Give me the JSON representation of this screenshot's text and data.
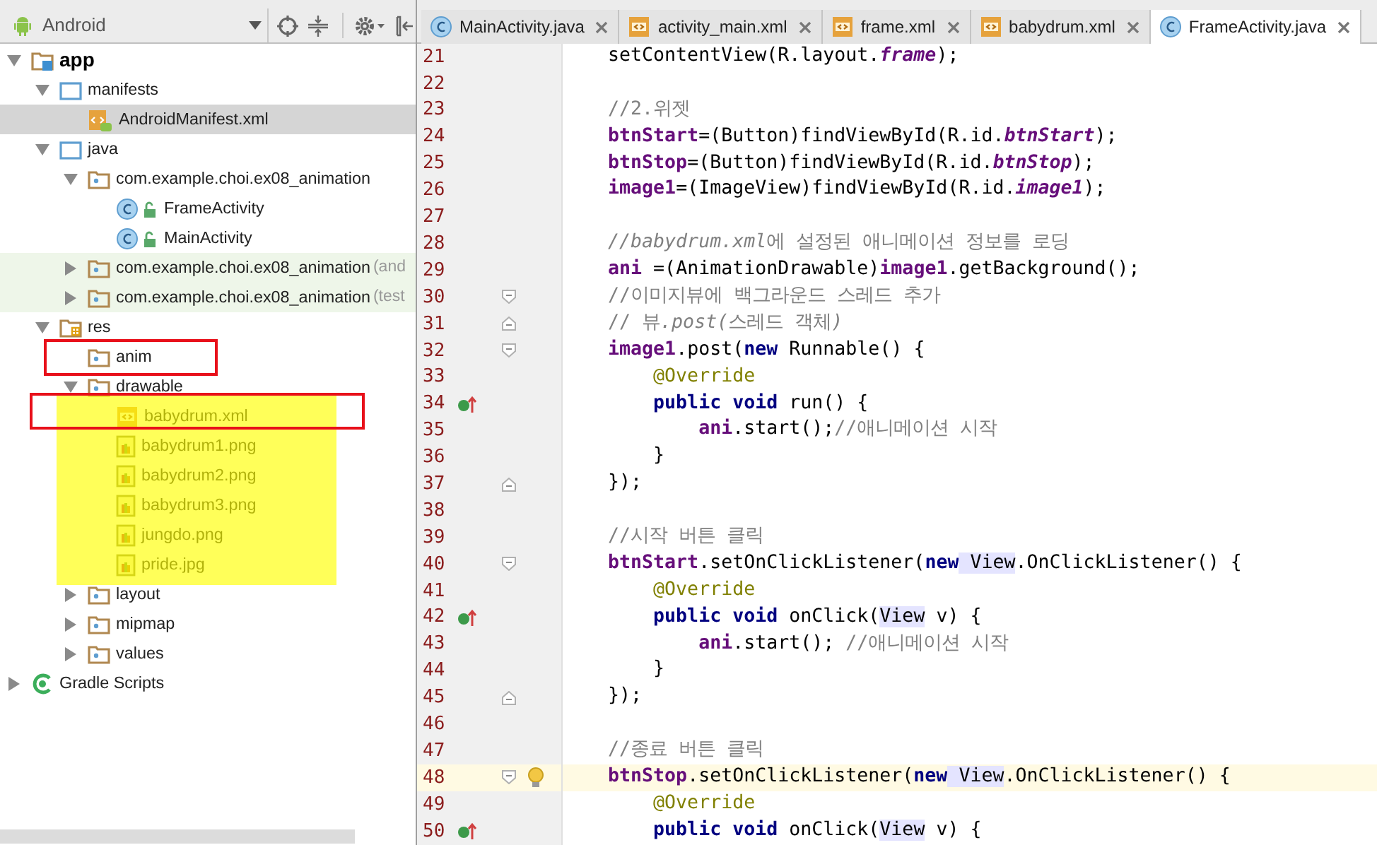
{
  "project_panel": {
    "view": "Android",
    "tree": [
      {
        "label": "app",
        "kind": "module",
        "expanded": true,
        "selected": false,
        "children": [
          {
            "label": "manifests",
            "kind": "folder",
            "expanded": true,
            "selected": false,
            "children": [
              {
                "label": "AndroidManifest.xml",
                "kind": "manifest",
                "selected": true
              }
            ]
          },
          {
            "label": "java",
            "kind": "folder",
            "expanded": true,
            "selected": false,
            "children": [
              {
                "label": "com.example.choi.ex08_animation",
                "kind": "package",
                "expanded": true,
                "selected": false,
                "children": [
                  {
                    "label": "FrameActivity",
                    "kind": "class",
                    "selected": false
                  },
                  {
                    "label": "MainActivity",
                    "kind": "class",
                    "selected": false
                  }
                ]
              },
              {
                "label": "com.example.choi.ex08_animation",
                "suffix": "(and",
                "kind": "package",
                "test": true,
                "expanded": false,
                "selected": false
              },
              {
                "label": "com.example.choi.ex08_animation",
                "suffix": "(test",
                "kind": "package",
                "test": true,
                "expanded": false,
                "selected": false
              }
            ]
          },
          {
            "label": "res",
            "kind": "res",
            "expanded": true,
            "selected": false,
            "children": [
              {
                "label": "anim",
                "kind": "resdir",
                "selected": false
              },
              {
                "label": "drawable",
                "kind": "resdir",
                "expanded": true,
                "selected": false,
                "children": [
                  {
                    "label": "babydrum.xml",
                    "kind": "xml",
                    "selected": false
                  },
                  {
                    "label": "babydrum1.png",
                    "kind": "image",
                    "selected": false
                  },
                  {
                    "label": "babydrum2.png",
                    "kind": "image",
                    "selected": false
                  },
                  {
                    "label": "babydrum3.png",
                    "kind": "image",
                    "selected": false
                  },
                  {
                    "label": "jungdo.png",
                    "kind": "image",
                    "selected": false
                  },
                  {
                    "label": "pride.jpg",
                    "kind": "image",
                    "selected": false
                  }
                ]
              },
              {
                "label": "layout",
                "kind": "resdir",
                "expanded": false,
                "selected": false
              },
              {
                "label": "mipmap",
                "kind": "resdir",
                "expanded": false,
                "selected": false
              },
              {
                "label": "values",
                "kind": "resdir",
                "expanded": false,
                "selected": false
              }
            ]
          }
        ]
      },
      {
        "label": "Gradle Scripts",
        "kind": "gradle",
        "expanded": false,
        "selected": false
      }
    ]
  },
  "editor": {
    "tabs": [
      {
        "label": "MainActivity.java",
        "kind": "class",
        "selected": false
      },
      {
        "label": "activity_main.xml",
        "kind": "xml",
        "selected": false
      },
      {
        "label": "frame.xml",
        "kind": "xml",
        "selected": false
      },
      {
        "label": "babydrum.xml",
        "kind": "xml",
        "selected": false
      },
      {
        "label": "FrameActivity.java",
        "kind": "class",
        "selected": true
      }
    ],
    "lines": [
      {
        "number": "21",
        "tokens": [
          {
            "kind": "plain",
            "text": "    setContentView(R.layout."
          },
          {
            "kind": "static",
            "text": "frame"
          },
          {
            "kind": "plain",
            "text": ");"
          }
        ]
      },
      {
        "number": "22"
      },
      {
        "number": "23",
        "tokens": [
          {
            "kind": "comment",
            "text": "    //2.위젯"
          }
        ]
      },
      {
        "number": "24",
        "tokens": [
          {
            "kind": "field",
            "text": "    btnStart"
          },
          {
            "kind": "plain",
            "text": "=(Button)findViewById(R.id."
          },
          {
            "kind": "static",
            "text": "btnStart"
          },
          {
            "kind": "plain",
            "text": ");"
          }
        ]
      },
      {
        "number": "25",
        "tokens": [
          {
            "kind": "field",
            "text": "    btnStop"
          },
          {
            "kind": "plain",
            "text": "=(Button)findViewById(R.id."
          },
          {
            "kind": "static",
            "text": "btnStop"
          },
          {
            "kind": "plain",
            "text": ");"
          }
        ]
      },
      {
        "number": "26",
        "tokens": [
          {
            "kind": "field",
            "text": "    image1"
          },
          {
            "kind": "plain",
            "text": "=(ImageView)findViewById(R.id."
          },
          {
            "kind": "static",
            "text": "image1"
          },
          {
            "kind": "plain",
            "text": ");"
          }
        ]
      },
      {
        "number": "27"
      },
      {
        "number": "28",
        "tokens": [
          {
            "kind": "comment-italic",
            "text": "    //babydrum.xml"
          },
          {
            "kind": "comment",
            "text": "에 설정된 애니메이션 정보를 로딩"
          }
        ]
      },
      {
        "number": "29",
        "tokens": [
          {
            "kind": "field",
            "text": "    ani"
          },
          {
            "kind": "plain",
            "text": " =(AnimationDrawable)"
          },
          {
            "kind": "field",
            "text": "image1"
          },
          {
            "kind": "plain",
            "text": ".getBackground();"
          }
        ]
      },
      {
        "number": "30",
        "fold_start": true,
        "tokens": [
          {
            "kind": "comment",
            "text": "    //이미지뷰에 백그라운드 스레드 추가"
          }
        ]
      },
      {
        "number": "31",
        "fold_end": true,
        "tokens": [
          {
            "kind": "comment",
            "text": "    // 뷰"
          },
          {
            "kind": "comment-italic",
            "text": ".post("
          },
          {
            "kind": "comment",
            "text": "스레드 객체"
          },
          {
            "kind": "comment-italic",
            "text": ")"
          }
        ]
      },
      {
        "number": "32",
        "fold_start": true,
        "tokens": [
          {
            "kind": "field",
            "text": "    image1"
          },
          {
            "kind": "plain",
            "text": ".post("
          },
          {
            "kind": "keyword",
            "text": "new"
          },
          {
            "kind": "plain",
            "text": " Runnable() {"
          }
        ]
      },
      {
        "number": "33",
        "tokens": [
          {
            "kind": "annotation",
            "text": "        @Override"
          }
        ]
      },
      {
        "number": "34",
        "override_marker": true,
        "tokens": [
          {
            "kind": "keyword",
            "text": "        public"
          },
          {
            "kind": "keyword",
            "text": " void"
          },
          {
            "kind": "plain",
            "text": " run() {"
          }
        ]
      },
      {
        "number": "35",
        "tokens": [
          {
            "kind": "field",
            "text": "            ani"
          },
          {
            "kind": "plain",
            "text": ".start();"
          },
          {
            "kind": "comment",
            "text": "//애니메이션 시작"
          }
        ]
      },
      {
        "number": "36",
        "tokens": [
          {
            "kind": "plain",
            "text": "        }"
          }
        ]
      },
      {
        "number": "37",
        "fold_end": true,
        "tokens": [
          {
            "kind": "plain",
            "text": "    });"
          }
        ]
      },
      {
        "number": "38"
      },
      {
        "number": "39",
        "tokens": [
          {
            "kind": "comment",
            "text": "    //시작 버튼 클릭"
          }
        ]
      },
      {
        "number": "40",
        "fold_start": true,
        "tokens": [
          {
            "kind": "field",
            "text": "    btnStart"
          },
          {
            "kind": "plain",
            "text": ".setOnClickListener("
          },
          {
            "kind": "keyword",
            "text": "new"
          },
          {
            "kind": "usage",
            "text": " View"
          },
          {
            "kind": "plain",
            "text": ".OnClickListener() {"
          }
        ]
      },
      {
        "number": "41",
        "tokens": [
          {
            "kind": "annotation",
            "text": "        @Override"
          }
        ]
      },
      {
        "number": "42",
        "override_marker": true,
        "tokens": [
          {
            "kind": "keyword",
            "text": "        public"
          },
          {
            "kind": "keyword",
            "text": " void"
          },
          {
            "kind": "plain",
            "text": " onClick("
          },
          {
            "kind": "usage",
            "text": "View"
          },
          {
            "kind": "plain",
            "text": " v) {"
          }
        ]
      },
      {
        "number": "43",
        "tokens": [
          {
            "kind": "field",
            "text": "            ani"
          },
          {
            "kind": "plain",
            "text": ".start(); "
          },
          {
            "kind": "comment",
            "text": "//애니메이션 시작"
          }
        ]
      },
      {
        "number": "44",
        "tokens": [
          {
            "kind": "plain",
            "text": "        }"
          }
        ]
      },
      {
        "number": "45",
        "fold_end": true,
        "tokens": [
          {
            "kind": "plain",
            "text": "    });"
          }
        ]
      },
      {
        "number": "46"
      },
      {
        "number": "47",
        "tokens": [
          {
            "kind": "comment",
            "text": "    //종료 버튼 클릭"
          }
        ]
      },
      {
        "number": "48",
        "fold_start": true,
        "bulb": true,
        "current": true,
        "tokens": [
          {
            "kind": "field",
            "text": "    btnStop"
          },
          {
            "kind": "plain",
            "text": ".setOnClickListener("
          },
          {
            "kind": "keyword",
            "text": "new"
          },
          {
            "kind": "usage",
            "text": " View"
          },
          {
            "kind": "plain",
            "text": ".OnClickListener() {"
          }
        ]
      },
      {
        "number": "49",
        "tokens": [
          {
            "kind": "annotation",
            "text": "        @Override"
          }
        ]
      },
      {
        "number": "50",
        "override_marker": true,
        "tokens": [
          {
            "kind": "keyword",
            "text": "        public"
          },
          {
            "kind": "keyword",
            "text": " void"
          },
          {
            "kind": "plain",
            "text": " onClick("
          },
          {
            "kind": "usage",
            "text": "View"
          },
          {
            "kind": "plain",
            "text": " v) {"
          }
        ]
      }
    ]
  }
}
